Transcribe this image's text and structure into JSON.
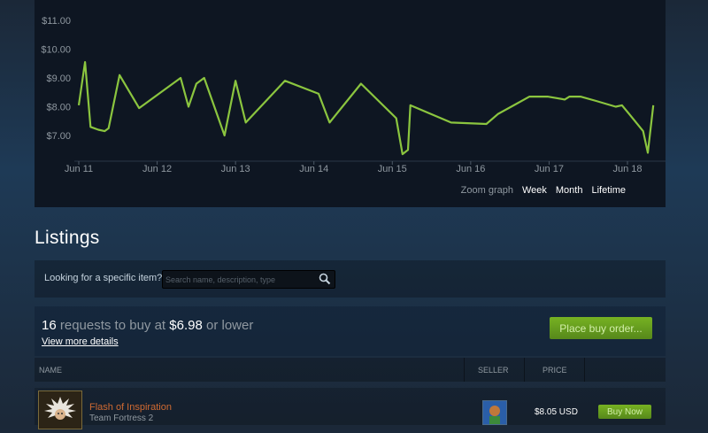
{
  "chart_data": {
    "type": "line",
    "y_ticks": [
      "$11.00",
      "$10.00",
      "$9.00",
      "$8.00",
      "$7.00"
    ],
    "x_ticks": [
      "Jun 11",
      "Jun 12",
      "Jun 13",
      "Jun 14",
      "Jun 15",
      "Jun 16",
      "Jun 17",
      "Jun 18"
    ],
    "ylim": [
      6.0,
      11.5
    ],
    "series": [
      {
        "color": "#8bc53f",
        "points": [
          [
            0.0,
            8.05
          ],
          [
            0.08,
            9.55
          ],
          [
            0.15,
            7.3
          ],
          [
            0.25,
            7.2
          ],
          [
            0.33,
            7.15
          ],
          [
            0.38,
            7.25
          ],
          [
            0.52,
            9.1
          ],
          [
            0.77,
            7.95
          ],
          [
            1.3,
            9.0
          ],
          [
            1.4,
            8.0
          ],
          [
            1.5,
            8.8
          ],
          [
            1.6,
            9.0
          ],
          [
            1.86,
            7.0
          ],
          [
            2.0,
            8.9
          ],
          [
            2.13,
            7.45
          ],
          [
            2.63,
            8.9
          ],
          [
            3.06,
            8.45
          ],
          [
            3.2,
            7.45
          ],
          [
            3.6,
            8.8
          ],
          [
            4.05,
            7.6
          ],
          [
            4.13,
            6.35
          ],
          [
            4.2,
            6.5
          ],
          [
            4.23,
            8.05
          ],
          [
            4.75,
            7.45
          ],
          [
            5.2,
            7.4
          ],
          [
            5.35,
            7.75
          ],
          [
            5.55,
            8.05
          ],
          [
            5.75,
            8.35
          ],
          [
            5.98,
            8.35
          ],
          [
            6.2,
            8.25
          ],
          [
            6.26,
            8.35
          ],
          [
            6.4,
            8.35
          ],
          [
            6.6,
            8.2
          ],
          [
            6.85,
            8.0
          ],
          [
            6.93,
            8.05
          ],
          [
            7.02,
            7.75
          ],
          [
            7.2,
            7.15
          ],
          [
            7.26,
            6.4
          ],
          [
            7.33,
            8.05
          ]
        ]
      }
    ],
    "grid": false
  },
  "zoom": {
    "label": "Zoom graph",
    "options": [
      "Week",
      "Month",
      "Lifetime"
    ]
  },
  "listings": {
    "title": "Listings",
    "search": {
      "label": "Looking for a specific item?",
      "placeholder": "Search name, description, type"
    },
    "buy_summary": {
      "count": "16",
      "text1": " requests to buy at ",
      "price": "$6.98",
      "text2": " or lower",
      "view_more": "View more details",
      "button": "Place buy order..."
    },
    "table": {
      "headers": {
        "name": "NAME",
        "seller": "SELLER",
        "price": "PRICE"
      },
      "rows": [
        {
          "name": "Flash of Inspiration",
          "game": "Team Fortress 2",
          "price": "$8.05 USD",
          "button": "Buy Now",
          "name_color": "#cf6a32"
        }
      ]
    }
  }
}
